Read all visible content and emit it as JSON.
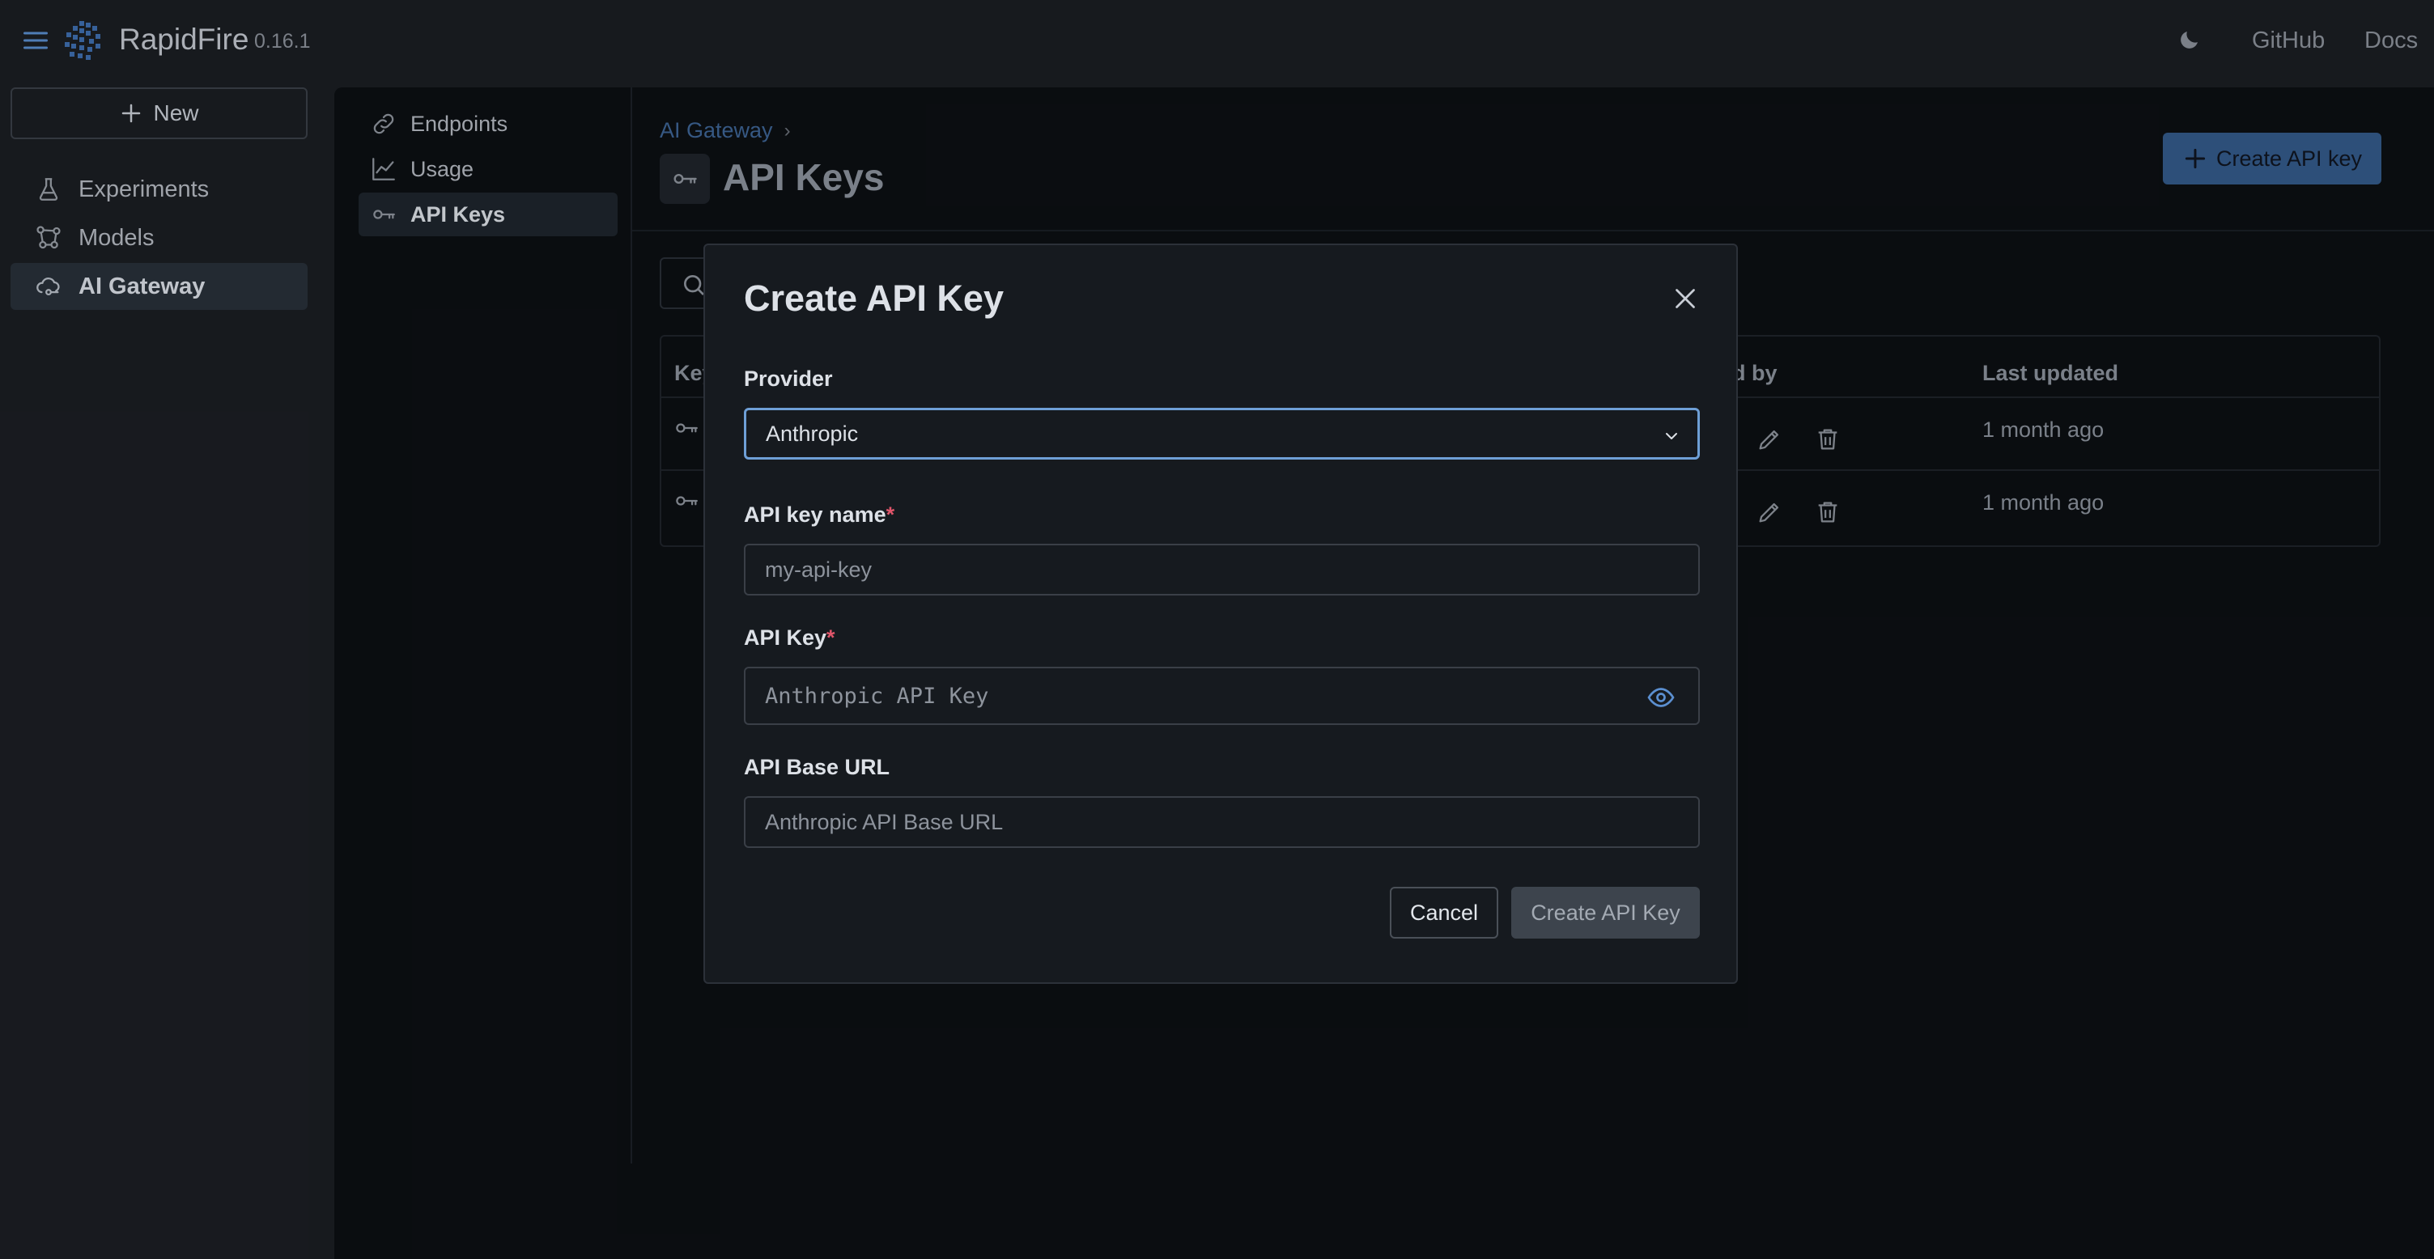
{
  "app": {
    "name": "RapidFire",
    "version": "0.16.1"
  },
  "topbar": {
    "github_label": "GitHub",
    "docs_label": "Docs"
  },
  "sidebar": {
    "new_label": "New",
    "items": [
      {
        "label": "Experiments",
        "icon": "flask-icon"
      },
      {
        "label": "Models",
        "icon": "models-icon"
      },
      {
        "label": "AI Gateway",
        "icon": "cloud-gateway-icon",
        "active": true
      }
    ]
  },
  "subnav": {
    "items": [
      {
        "label": "Endpoints",
        "icon": "link-icon"
      },
      {
        "label": "Usage",
        "icon": "chart-line-icon"
      },
      {
        "label": "API Keys",
        "icon": "key-icon",
        "active": true
      }
    ]
  },
  "page": {
    "breadcrumb": "AI Gateway",
    "breadcrumb_sep": "›",
    "title": "API Keys",
    "create_button": "Create API key"
  },
  "table": {
    "columns": {
      "key": "Key",
      "created_by": "ed by",
      "last_updated": "Last updated"
    },
    "rows": [
      {
        "last_updated": "1 month ago"
      },
      {
        "last_updated": "1 month ago"
      }
    ]
  },
  "modal": {
    "title": "Create API Key",
    "provider": {
      "label": "Provider",
      "value": "Anthropic"
    },
    "api_key_name": {
      "label": "API key name",
      "required_mark": "*",
      "placeholder": "my-api-key"
    },
    "api_key": {
      "label": "API Key",
      "required_mark": "*",
      "placeholder": "Anthropic API Key"
    },
    "api_base_url": {
      "label": "API Base URL",
      "placeholder": "Anthropic API Base URL"
    },
    "cancel_label": "Cancel",
    "submit_label": "Create API Key"
  },
  "colors": {
    "accent": "#345a8a",
    "focus_ring": "#6e9fd6",
    "required": "#e0556a",
    "background": "#1b1e23",
    "panel": "#0c0f13"
  }
}
